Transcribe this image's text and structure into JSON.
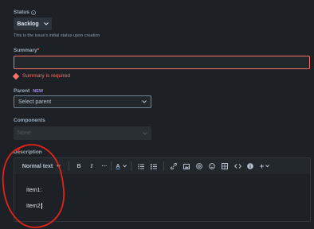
{
  "status": {
    "label": "Status",
    "info_icon": "info-circle-icon",
    "value": "Backlog",
    "help_text": "This is the issue's initial status upon creation"
  },
  "summary": {
    "label": "Summary",
    "required_marker": "*",
    "value": "",
    "error_text": "Summary is required"
  },
  "parent": {
    "label": "Parent",
    "badge": "NEW",
    "placeholder": "Select parent"
  },
  "components": {
    "label": "Components",
    "value": "None"
  },
  "description": {
    "label": "Description",
    "toolbar": {
      "text_style": "Normal text",
      "bold": "B",
      "italic": "I",
      "more": "···",
      "text_color": "A",
      "icons": [
        "bullet-list-icon",
        "numbered-list-icon",
        "link-icon",
        "image-icon",
        "mention-icon",
        "emoji-icon",
        "table-icon",
        "code-icon",
        "info-icon",
        "plus-icon"
      ],
      "plus": "+"
    },
    "lines": [
      "Item1:",
      "Item2:"
    ]
  },
  "colors": {
    "background": "#1d2125",
    "error": "#f87168",
    "annotation": "#e2231a"
  }
}
